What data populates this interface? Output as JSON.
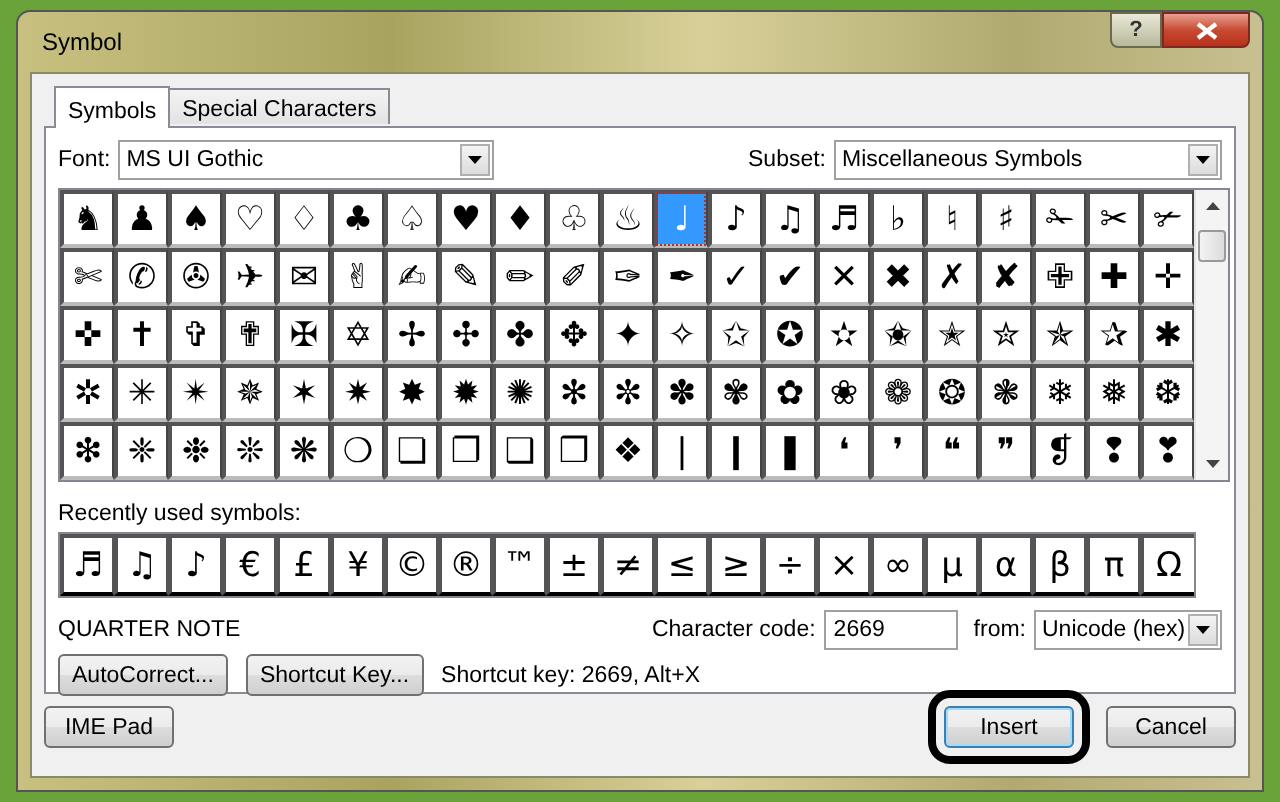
{
  "window": {
    "title": "Symbol",
    "help_button": "?"
  },
  "tabs": [
    {
      "label": "Symbols",
      "selected": true
    },
    {
      "label": "Special Characters",
      "selected": false
    }
  ],
  "font": {
    "label": "Font:",
    "value": "MS UI Gothic"
  },
  "subset": {
    "label": "Subset:",
    "value": "Miscellaneous Symbols"
  },
  "symbol_grid": {
    "rows": [
      {
        "cells": [
          {
            "symbol": "♞",
            "selected": false
          },
          {
            "symbol": "♟",
            "selected": false
          },
          {
            "symbol": "♠",
            "selected": false
          },
          {
            "symbol": "♡",
            "selected": false
          },
          {
            "symbol": "♢",
            "selected": false
          },
          {
            "symbol": "♣",
            "selected": false
          },
          {
            "symbol": "♤",
            "selected": false
          },
          {
            "symbol": "♥",
            "selected": false
          },
          {
            "symbol": "♦",
            "selected": false
          },
          {
            "symbol": "♧",
            "selected": false
          },
          {
            "symbol": "♨",
            "selected": false
          },
          {
            "symbol": "♩",
            "selected": true
          },
          {
            "symbol": "♪",
            "selected": false
          },
          {
            "symbol": "♫",
            "selected": false
          },
          {
            "symbol": "♬",
            "selected": false
          },
          {
            "symbol": "♭",
            "selected": false
          },
          {
            "symbol": "♮",
            "selected": false
          },
          {
            "symbol": "♯",
            "selected": false
          },
          {
            "symbol": "✁",
            "selected": false
          },
          {
            "symbol": "✂",
            "selected": false
          },
          {
            "symbol": "✃",
            "selected": false
          }
        ]
      },
      {
        "cells": [
          {
            "symbol": "✄",
            "selected": false
          },
          {
            "symbol": "✆",
            "selected": false
          },
          {
            "symbol": "✇",
            "selected": false
          },
          {
            "symbol": "✈",
            "selected": false
          },
          {
            "symbol": "✉",
            "selected": false
          },
          {
            "symbol": "✌",
            "selected": false
          },
          {
            "symbol": "✍",
            "selected": false
          },
          {
            "symbol": "✎",
            "selected": false
          },
          {
            "symbol": "✏",
            "selected": false
          },
          {
            "symbol": "✐",
            "selected": false
          },
          {
            "symbol": "✑",
            "selected": false
          },
          {
            "symbol": "✒",
            "selected": false
          },
          {
            "symbol": "✓",
            "selected": false
          },
          {
            "symbol": "✔",
            "selected": false
          },
          {
            "symbol": "✕",
            "selected": false
          },
          {
            "symbol": "✖",
            "selected": false
          },
          {
            "symbol": "✗",
            "selected": false
          },
          {
            "symbol": "✘",
            "selected": false
          },
          {
            "symbol": "✙",
            "selected": false
          },
          {
            "symbol": "✚",
            "selected": false
          },
          {
            "symbol": "✛",
            "selected": false
          }
        ]
      },
      {
        "cells": [
          {
            "symbol": "✜",
            "selected": false
          },
          {
            "symbol": "✝",
            "selected": false
          },
          {
            "symbol": "✞",
            "selected": false
          },
          {
            "symbol": "✟",
            "selected": false
          },
          {
            "symbol": "✠",
            "selected": false
          },
          {
            "symbol": "✡",
            "selected": false
          },
          {
            "symbol": "✢",
            "selected": false
          },
          {
            "symbol": "✣",
            "selected": false
          },
          {
            "symbol": "✤",
            "selected": false
          },
          {
            "symbol": "✥",
            "selected": false
          },
          {
            "symbol": "✦",
            "selected": false
          },
          {
            "symbol": "✧",
            "selected": false
          },
          {
            "symbol": "✩",
            "selected": false
          },
          {
            "symbol": "✪",
            "selected": false
          },
          {
            "symbol": "✫",
            "selected": false
          },
          {
            "symbol": "✬",
            "selected": false
          },
          {
            "symbol": "✭",
            "selected": false
          },
          {
            "symbol": "✮",
            "selected": false
          },
          {
            "symbol": "✯",
            "selected": false
          },
          {
            "symbol": "✰",
            "selected": false
          },
          {
            "symbol": "✱",
            "selected": false
          }
        ]
      },
      {
        "cells": [
          {
            "symbol": "✲",
            "selected": false
          },
          {
            "symbol": "✳",
            "selected": false
          },
          {
            "symbol": "✴",
            "selected": false
          },
          {
            "symbol": "✵",
            "selected": false
          },
          {
            "symbol": "✶",
            "selected": false
          },
          {
            "symbol": "✷",
            "selected": false
          },
          {
            "symbol": "✸",
            "selected": false
          },
          {
            "symbol": "✹",
            "selected": false
          },
          {
            "symbol": "✺",
            "selected": false
          },
          {
            "symbol": "✻",
            "selected": false
          },
          {
            "symbol": "✼",
            "selected": false
          },
          {
            "symbol": "✽",
            "selected": false
          },
          {
            "symbol": "✾",
            "selected": false
          },
          {
            "symbol": "✿",
            "selected": false
          },
          {
            "symbol": "❀",
            "selected": false
          },
          {
            "symbol": "❁",
            "selected": false
          },
          {
            "symbol": "❂",
            "selected": false
          },
          {
            "symbol": "❃",
            "selected": false
          },
          {
            "symbol": "❄",
            "selected": false
          },
          {
            "symbol": "❅",
            "selected": false
          },
          {
            "symbol": "❆",
            "selected": false
          }
        ]
      },
      {
        "cells": [
          {
            "symbol": "❇",
            "selected": false
          },
          {
            "symbol": "❈",
            "selected": false
          },
          {
            "symbol": "❉",
            "selected": false
          },
          {
            "symbol": "❊",
            "selected": false
          },
          {
            "symbol": "❋",
            "selected": false
          },
          {
            "symbol": "❍",
            "selected": false
          },
          {
            "symbol": "❏",
            "selected": false
          },
          {
            "symbol": "❐",
            "selected": false
          },
          {
            "symbol": "❑",
            "selected": false
          },
          {
            "symbol": "❒",
            "selected": false
          },
          {
            "symbol": "❖",
            "selected": false
          },
          {
            "symbol": "❘",
            "selected": false
          },
          {
            "symbol": "❙",
            "selected": false
          },
          {
            "symbol": "❚",
            "selected": false
          },
          {
            "symbol": "❛",
            "selected": false
          },
          {
            "symbol": "❜",
            "selected": false
          },
          {
            "symbol": "❝",
            "selected": false
          },
          {
            "symbol": "❞",
            "selected": false
          },
          {
            "symbol": "❡",
            "selected": false
          },
          {
            "symbol": "❢",
            "selected": false
          },
          {
            "symbol": "❣",
            "selected": false
          }
        ]
      }
    ]
  },
  "recently_used": {
    "label": "Recently used symbols:",
    "symbols": [
      "♬",
      "♫",
      "♪",
      "€",
      "£",
      "¥",
      "©",
      "®",
      "™",
      "±",
      "≠",
      "≤",
      "≥",
      "÷",
      "×",
      "∞",
      "μ",
      "α",
      "β",
      "π",
      "Ω"
    ]
  },
  "character_name": "QUARTER NOTE",
  "character_code": {
    "label": "Character code:",
    "value": "2669"
  },
  "from": {
    "label": "from:",
    "value": "Unicode (hex)"
  },
  "panel_buttons": [
    {
      "label": "AutoCorrect..."
    },
    {
      "label": "Shortcut Key..."
    }
  ],
  "shortcut_info": "Shortcut key: 2669, Alt+X",
  "footer_buttons": [
    {
      "label": "IME Pad",
      "highlighted": false
    },
    {
      "label": "Insert",
      "highlighted": true
    },
    {
      "label": "Cancel",
      "highlighted": false
    }
  ]
}
